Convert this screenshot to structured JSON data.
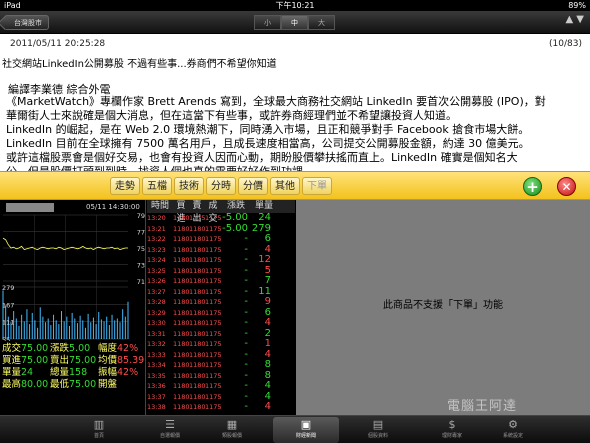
{
  "status_bar": {
    "device": "iPad",
    "time": "下午10:21",
    "battery": "89%"
  },
  "header": {
    "back_label": "台灣股市",
    "segments": [
      {
        "label": "小",
        "selected": false
      },
      {
        "label": "中",
        "selected": true
      },
      {
        "label": "大",
        "selected": false
      }
    ]
  },
  "article": {
    "datetime": "2011/05/11 20:25:28",
    "page": "(10/83)",
    "headline": "社交網站LinkedIn公開募股 不過有些事...券商們不希望你知道",
    "byline": "編譯李業德 綜合外電",
    "paragraphs": [
      "《MarketWatch》專欄作家 Brett Arends 寫到，全球最大商務社交網站 LinkedIn 要首次公開募股 (IPO)，對",
      "華爾街人士來說確是個大消息，但在這當下有些事，或許券商經理們並不希望讓投資人知道。",
      "LinkedIn 的崛起，是在 Web 2.0 環境熱潮下，同時湧入市場，且正和競爭對手 Facebook 搶食市場大餅。",
      "LinkedIn 目前在全球擁有 7500 萬名用戶，且成長速度相當高，公司提交公開募股金額，約達 30 億美元。",
      "或許這檔股票會是個好交易，也會有投資人因而心動，期盼股價攀扶搖而直上。LinkedIn 確實是個知名大",
      "公，但是股價打頭到到時，找資人個也真的需要好好作到功課。"
    ]
  },
  "quote_toolbar": {
    "tabs": [
      {
        "label": "走勢",
        "enabled": true
      },
      {
        "label": "五檔",
        "enabled": true
      },
      {
        "label": "技術",
        "enabled": true
      },
      {
        "label": "分時",
        "enabled": true
      },
      {
        "label": "分價",
        "enabled": true
      },
      {
        "label": "其他",
        "enabled": true
      },
      {
        "label": "下單",
        "enabled": false
      }
    ],
    "add_icon": "plus-icon",
    "close_icon": "x-icon"
  },
  "chart_data": {
    "type": "line",
    "date": "05/11 14:30:00",
    "price_axis": [
      "79",
      "77",
      "75",
      "73",
      "71"
    ],
    "volume_axis": [
      "279",
      "167",
      "111",
      "55"
    ],
    "series": [
      {
        "name": "price",
        "color": "#ffff55",
        "values": [
          76.2,
          76.0,
          75.4,
          75.0,
          75.1,
          74.9,
          75.0,
          75.2,
          74.8,
          74.9,
          75.0,
          75.1,
          74.9,
          74.8,
          75.0,
          75.1,
          75.0,
          74.9,
          75.0,
          75.0,
          74.9,
          75.1,
          75.0,
          74.8,
          74.9,
          75.0,
          75.1,
          75.0,
          74.9,
          75.0,
          75.2,
          75.0,
          74.9,
          75.0,
          74.8,
          75.0,
          75.1,
          75.0,
          74.9,
          75.0,
          75.0,
          75.1,
          74.9,
          75.0,
          74.8,
          74.9,
          75.0,
          75.0
        ]
      },
      {
        "name": "volume",
        "color": "#44bbff",
        "values": [
          260,
          180,
          120,
          90,
          150,
          110,
          70,
          130,
          95,
          160,
          80,
          140,
          100,
          60,
          170,
          120,
          90,
          110,
          75,
          130,
          100,
          80,
          150,
          95,
          120,
          70,
          140,
          110,
          85,
          125,
          100,
          60,
          135,
          90,
          115,
          80,
          145,
          105,
          95,
          120,
          75,
          130,
          100,
          110,
          90,
          160,
          120,
          200
        ]
      }
    ]
  },
  "stats": {
    "rows": [
      [
        {
          "label": "成交",
          "value": "75.00"
        },
        {
          "label": "漲跌",
          "value": "5.00"
        },
        {
          "label": "幅度",
          "value": "42%"
        }
      ],
      [
        {
          "label": "買進",
          "value": "75.00"
        },
        {
          "label": "賣出",
          "value": "75.00"
        },
        {
          "label": "均價",
          "value": "85.39"
        }
      ],
      [
        {
          "label": "單量",
          "value": "24"
        },
        {
          "label": "總量",
          "value": "158"
        },
        {
          "label": "振幅",
          "value": "42%"
        }
      ],
      [
        {
          "label": "最高",
          "value": "80.00"
        },
        {
          "label": "最低",
          "value": "75.00"
        },
        {
          "label": "開盤",
          "value": ""
        }
      ]
    ]
  },
  "ticks": {
    "headers": [
      "時間",
      "買進",
      "賣出",
      "成交",
      "漲跌",
      "單量"
    ],
    "rows": [
      {
        "time": "13:20",
        "bid": "1180.0",
        "ask": "1175.0",
        "deal": "1175.0",
        "change": "-5.00",
        "volume": "24",
        "vol_red": false
      },
      {
        "time": "13:21",
        "bid": "1180.0",
        "ask": "1180.0",
        "deal": "1175.0",
        "change": "-5.00",
        "volume": "279",
        "vol_red": false
      },
      {
        "time": "13:22",
        "bid": "1180.0",
        "ask": "1180.0",
        "deal": "1175.0",
        "change": "-",
        "volume": "6",
        "vol_red": false
      },
      {
        "time": "13:23",
        "bid": "1180.0",
        "ask": "1180.0",
        "deal": "1175.0",
        "change": "-",
        "volume": "4",
        "vol_red": true
      },
      {
        "time": "13:24",
        "bid": "1180.0",
        "ask": "1180.0",
        "deal": "1175.0",
        "change": "-",
        "volume": "12",
        "vol_red": true
      },
      {
        "time": "13:25",
        "bid": "1180.0",
        "ask": "1180.0",
        "deal": "1175.0",
        "change": "-",
        "volume": "5",
        "vol_red": true
      },
      {
        "time": "13:26",
        "bid": "1180.0",
        "ask": "1180.0",
        "deal": "1175.0",
        "change": "-",
        "volume": "7",
        "vol_red": false
      },
      {
        "time": "13:27",
        "bid": "1180.0",
        "ask": "1180.0",
        "deal": "1175.0",
        "change": "-",
        "volume": "11",
        "vol_red": false
      },
      {
        "time": "13:28",
        "bid": "1180.0",
        "ask": "1180.0",
        "deal": "1175.0",
        "change": "-",
        "volume": "9",
        "vol_red": true
      },
      {
        "time": "13:29",
        "bid": "1180.0",
        "ask": "1180.0",
        "deal": "1175.0",
        "change": "-",
        "volume": "6",
        "vol_red": false
      },
      {
        "time": "13:30",
        "bid": "1180.0",
        "ask": "1180.0",
        "deal": "1175.0",
        "change": "-",
        "volume": "4",
        "vol_red": true
      },
      {
        "time": "13:31",
        "bid": "1180.0",
        "ask": "1180.0",
        "deal": "1175.0",
        "change": "-",
        "volume": "2",
        "vol_red": false
      },
      {
        "time": "13:32",
        "bid": "1180.0",
        "ask": "1180.0",
        "deal": "1175.0",
        "change": "-",
        "volume": "1",
        "vol_red": true
      },
      {
        "time": "13:33",
        "bid": "1180.0",
        "ask": "1180.0",
        "deal": "1175.0",
        "change": "-",
        "volume": "4",
        "vol_red": true
      },
      {
        "time": "13:34",
        "bid": "1180.0",
        "ask": "1180.0",
        "deal": "1175.0",
        "change": "-",
        "volume": "8",
        "vol_red": false
      },
      {
        "time": "13:35",
        "bid": "1180.0",
        "ask": "1180.0",
        "deal": "1175.0",
        "change": "-",
        "volume": "8",
        "vol_red": false
      },
      {
        "time": "13:36",
        "bid": "1180.0",
        "ask": "1180.0",
        "deal": "1175.0",
        "change": "-",
        "volume": "4",
        "vol_red": false
      },
      {
        "time": "13:37",
        "bid": "1180.0",
        "ask": "1180.0",
        "deal": "1175.0",
        "change": "-",
        "volume": "4",
        "vol_red": false
      },
      {
        "time": "13:38",
        "bid": "1180.0",
        "ask": "1180.0",
        "deal": "1175.0",
        "change": "-",
        "volume": "4",
        "vol_red": true
      }
    ]
  },
  "order_panel": {
    "message": "此商品不支援「下單」功能"
  },
  "tabbar": {
    "items": [
      {
        "label": "首頁",
        "icon": "chart-icon",
        "glyph": "▥",
        "selected": false
      },
      {
        "label": "自選報價",
        "icon": "list-icon",
        "glyph": "☰",
        "selected": false
      },
      {
        "label": "類股報價",
        "icon": "grid-icon",
        "glyph": "▦",
        "selected": false
      },
      {
        "label": "財經新聞",
        "icon": "tv-icon",
        "glyph": "▣",
        "selected": true
      },
      {
        "label": "個股資料",
        "icon": "document-icon",
        "glyph": "▤",
        "selected": false
      },
      {
        "label": "理財專家",
        "icon": "dollar-icon",
        "glyph": "$",
        "selected": false
      },
      {
        "label": "系統設定",
        "icon": "gear-icon",
        "glyph": "⚙",
        "selected": false
      }
    ]
  },
  "watermark": "電腦王阿達"
}
